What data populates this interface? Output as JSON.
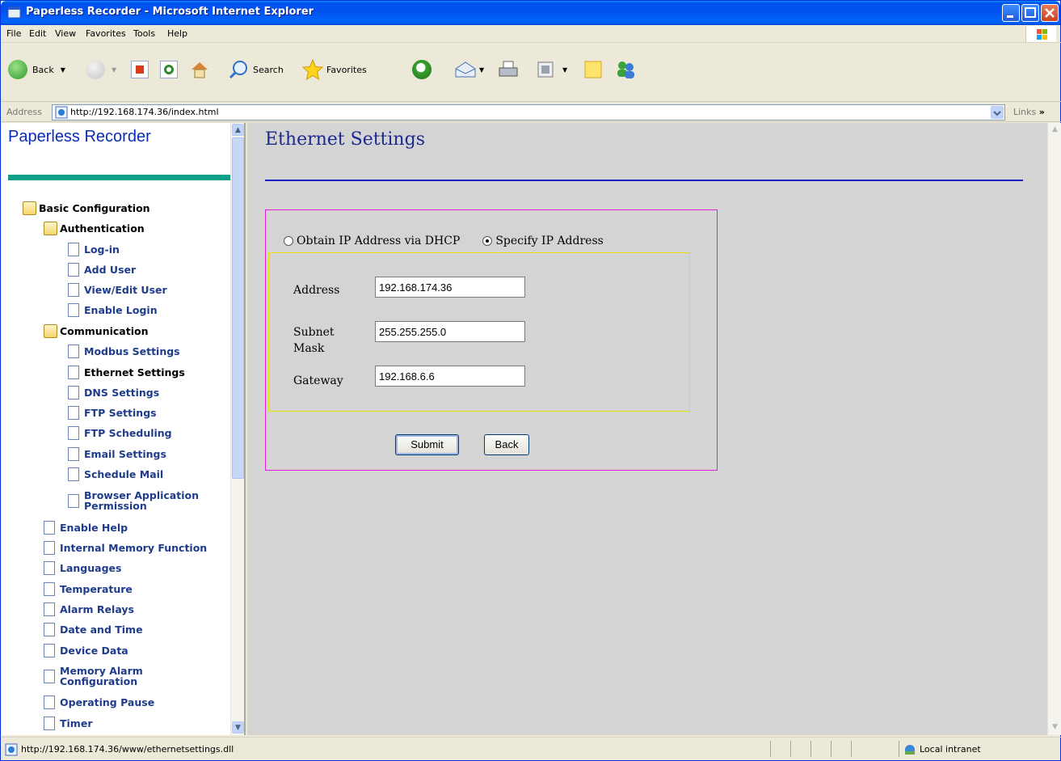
{
  "window": {
    "title": "Paperless Recorder - Microsoft Internet Explorer"
  },
  "menu": [
    "File",
    "Edit",
    "View",
    "Favorites",
    "Tools",
    "Help"
  ],
  "toolbar": {
    "back": "Back",
    "search": "Search",
    "favorites": "Favorites"
  },
  "address": {
    "label": "Address",
    "url": "http://192.168.174.36/index.html",
    "links": "Links"
  },
  "sidebar": {
    "title": "Paperless Recorder",
    "tree": [
      {
        "label": "Basic Configuration",
        "type": "folder"
      },
      {
        "label": "Authentication",
        "type": "folder"
      },
      {
        "label": "Log-in",
        "type": "page"
      },
      {
        "label": "Add User",
        "type": "page"
      },
      {
        "label": "View/Edit User",
        "type": "page"
      },
      {
        "label": "Enable Login",
        "type": "page"
      },
      {
        "label": "Communication",
        "type": "folder"
      },
      {
        "label": "Modbus Settings",
        "type": "page"
      },
      {
        "label": "Ethernet Settings",
        "type": "page",
        "active": true
      },
      {
        "label": "DNS Settings",
        "type": "page"
      },
      {
        "label": "FTP Settings",
        "type": "page"
      },
      {
        "label": "FTP Scheduling",
        "type": "page"
      },
      {
        "label": "Email Settings",
        "type": "page"
      },
      {
        "label": "Schedule Mail",
        "type": "page"
      },
      {
        "label": "Browser Application Permission",
        "line1": "Browser Application",
        "line2": "Permission",
        "type": "page"
      },
      {
        "label": "Enable Help",
        "type": "page"
      },
      {
        "label": "Internal Memory Function",
        "type": "page"
      },
      {
        "label": "Languages",
        "type": "page"
      },
      {
        "label": "Temperature",
        "type": "page"
      },
      {
        "label": "Alarm Relays",
        "type": "page"
      },
      {
        "label": "Date and Time",
        "type": "page"
      },
      {
        "label": "Device Data",
        "type": "page"
      },
      {
        "label": "Memory Alarm Configuration",
        "line1": "Memory Alarm",
        "line2": "Configuration",
        "type": "page"
      },
      {
        "label": "Operating Pause",
        "type": "page"
      },
      {
        "label": "Timer",
        "type": "page"
      }
    ]
  },
  "main": {
    "title": "Ethernet Settings",
    "radio_dhcp": "Obtain IP Address via DHCP",
    "radio_static": "Specify IP Address",
    "selected_mode": "Specify IP Address",
    "address_label": "Address",
    "address_value": "192.168.174.36",
    "subnet_label_1": "Subnet",
    "subnet_label_2": "Mask",
    "subnet_value": "255.255.255.0",
    "gateway_label": "Gateway",
    "gateway_value": "192.168.6.6",
    "submit": "Submit",
    "back": "Back"
  },
  "status": {
    "text": "http://192.168.174.36/www/ethernetsettings.dll",
    "zone": "Local intranet"
  }
}
